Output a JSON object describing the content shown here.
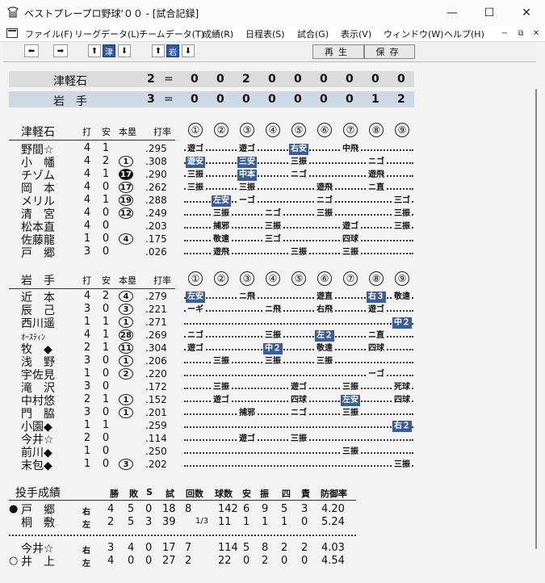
{
  "window": {
    "title": "ベストプレープロ野球'００ - [試合記録]",
    "buttons": [
      "—",
      "☐",
      "✕"
    ]
  },
  "menu": {
    "items": [
      "ファイル(F)",
      "リーグデータ(L)",
      "チームデータ(T)",
      "成績(R)",
      "日程表(S)",
      "試合(G)",
      "表示(V)",
      "ウィンドウ(W)",
      "ヘルプ(H)"
    ],
    "mdi": [
      "−",
      "⧉",
      "✕"
    ]
  },
  "toolbar": {
    "team1": "津",
    "team2": "岩",
    "play_label": "再生",
    "save_label": "保存"
  },
  "colors": {
    "highlight": "#3a5f96",
    "score_bg_1": "#dcdcdc",
    "score_bg_2": "#cfd9e6"
  },
  "scoreboard": [
    {
      "team": "津軽石",
      "total": "2",
      "eq": "=",
      "innings": [
        "0",
        "0",
        "2",
        "0",
        "0",
        "0",
        "0",
        "0",
        "0"
      ]
    },
    {
      "team": "岩　手",
      "total": "3",
      "eq": "=",
      "innings": [
        "0",
        "0",
        "0",
        "0",
        "0",
        "0",
        "0",
        "1",
        "2"
      ]
    }
  ],
  "batting_headers": {
    "ab": "打",
    "h": "安",
    "hr": "本塁",
    "avg": "打率"
  },
  "inning_labels": [
    "①",
    "②",
    "③",
    "④",
    "⑤",
    "⑥",
    "⑦",
    "⑧",
    "⑨"
  ],
  "team1": {
    "name": "津軽石",
    "players": [
      {
        "name": "野間☆",
        "ab": "4",
        "h": "1",
        "hr": "",
        "avg": ".295",
        "results": [
          [
            "0",
            "遊ゴ"
          ],
          [
            "2",
            "遊ゴ"
          ],
          [
            "4",
            "右安",
            "hl"
          ],
          [
            "6",
            "中飛"
          ]
        ]
      },
      {
        "name": "小　幡",
        "ab": "4",
        "h": "2",
        "hr": "1",
        "hrf": false,
        "avg": ".308",
        "results": [
          [
            "0",
            "遊安",
            "hl"
          ],
          [
            "2",
            "三安",
            "hl"
          ],
          [
            "4",
            "三振"
          ],
          [
            "7",
            "ニゴ"
          ]
        ]
      },
      {
        "name": "チゾム",
        "ab": "4",
        "h": "1",
        "hr": "17",
        "hrf": true,
        "avg": ".290",
        "results": [
          [
            "0",
            "三振"
          ],
          [
            "2",
            "中本",
            "hl"
          ],
          [
            "4",
            "ニゴ"
          ],
          [
            "7",
            "遊飛"
          ]
        ]
      },
      {
        "name": "岡　本",
        "ab": "4",
        "h": "0",
        "hr": "17",
        "hrf": false,
        "avg": ".262",
        "results": [
          [
            "0",
            "三振"
          ],
          [
            "2",
            "三振"
          ],
          [
            "5",
            "遊飛"
          ],
          [
            "7",
            "ニ直"
          ]
        ]
      },
      {
        "name": "メリル",
        "ab": "4",
        "h": "1",
        "hr": "19",
        "hrf": false,
        "avg": ".288",
        "results": [
          [
            "1",
            "左安",
            "hl"
          ],
          [
            "2",
            "ーゴ"
          ],
          [
            "5",
            "ニゴ"
          ],
          [
            "8",
            "三ゴ"
          ]
        ]
      },
      {
        "name": "清　宮",
        "ab": "4",
        "h": "0",
        "hr": "12",
        "hrf": false,
        "avg": ".249",
        "results": [
          [
            "1",
            "三振"
          ],
          [
            "3",
            "ニゴ"
          ],
          [
            "5",
            "三振"
          ],
          [
            "8",
            "三振"
          ]
        ]
      },
      {
        "name": "松本直",
        "ab": "4",
        "h": "0",
        "hr": "",
        "avg": ".203",
        "results": [
          [
            "1",
            "捕邪"
          ],
          [
            "3",
            "三振"
          ],
          [
            "6",
            "遊ゴ"
          ],
          [
            "8",
            "三振"
          ]
        ]
      },
      {
        "name": "佐藤龍",
        "ab": "1",
        "h": "0",
        "hr": "4",
        "hrf": false,
        "avg": ".175",
        "results": [
          [
            "1",
            "敬遠"
          ],
          [
            "3",
            "三ゴ"
          ],
          [
            "6",
            "四球"
          ]
        ]
      },
      {
        "name": "戸　郷",
        "ab": "3",
        "h": "0",
        "hr": "",
        "avg": ".026",
        "results": [
          [
            "1",
            "遊飛"
          ],
          [
            "4",
            "三振"
          ],
          [
            "6",
            "三振"
          ]
        ]
      }
    ]
  },
  "team2": {
    "name": "岩　手",
    "players": [
      {
        "name": "近　本",
        "ab": "4",
        "h": "2",
        "hr": "4",
        "hrf": false,
        "avg": ".279",
        "results": [
          [
            "0",
            "左安",
            "hl"
          ],
          [
            "2",
            "ニ飛"
          ],
          [
            "5",
            "遊直"
          ],
          [
            "7",
            "右３",
            "hl"
          ],
          [
            "8",
            "敬遠"
          ]
        ]
      },
      {
        "name": "辰　己",
        "ab": "3",
        "h": "0",
        "hr": "3",
        "hrf": false,
        "avg": ".221",
        "results": [
          [
            "0",
            "ーギ"
          ],
          [
            "3",
            "ニ飛"
          ],
          [
            "5",
            "右飛"
          ],
          [
            "7",
            "遊ゴ"
          ]
        ]
      },
      {
        "name": "西川遥",
        "ab": "1",
        "h": "1",
        "hr": "1",
        "hrf": false,
        "avg": ".271",
        "results": [
          [
            "8",
            "中２",
            "hl"
          ]
        ]
      },
      {
        "name": "ｵｰｽﾃｨﾝ",
        "ab": "4",
        "h": "1",
        "hr": "28",
        "hrf": false,
        "avg": ".269",
        "results": [
          [
            "0",
            "ニゴ"
          ],
          [
            "3",
            "三振"
          ],
          [
            "5",
            "左２",
            "hl"
          ],
          [
            "7",
            "ニ直"
          ]
        ]
      },
      {
        "name": "牧　◆",
        "ab": "2",
        "h": "1",
        "hr": "11",
        "hrf": false,
        "avg": ".304",
        "results": [
          [
            "0",
            "遊ゴ"
          ],
          [
            "3",
            "中２",
            "hl"
          ],
          [
            "5",
            "敬遠"
          ],
          [
            "7",
            "四球"
          ]
        ]
      },
      {
        "name": "浅　野",
        "ab": "3",
        "h": "0",
        "hr": "1",
        "hrf": false,
        "avg": ".206",
        "results": [
          [
            "1",
            "三振"
          ],
          [
            "3",
            "三振"
          ],
          [
            "5",
            "三振"
          ]
        ]
      },
      {
        "name": "宇佐見",
        "ab": "1",
        "h": "0",
        "hr": "2",
        "hrf": false,
        "avg": ".220",
        "results": [
          [
            "7",
            "ーゴ"
          ]
        ]
      },
      {
        "name": "滝　沢",
        "ab": "3",
        "h": "0",
        "hr": "",
        "avg": ".172",
        "results": [
          [
            "1",
            "三振"
          ],
          [
            "4",
            "遊ゴ"
          ],
          [
            "6",
            "三振"
          ],
          [
            "8",
            "死球"
          ]
        ]
      },
      {
        "name": "中村悠",
        "ab": "2",
        "h": "1",
        "hr": "1",
        "hrf": false,
        "avg": ".152",
        "results": [
          [
            "1",
            "遊ゴ"
          ],
          [
            "4",
            "四球"
          ],
          [
            "6",
            "左安",
            "hl"
          ],
          [
            "8",
            "四球"
          ]
        ]
      },
      {
        "name": "門　脇",
        "ab": "3",
        "h": "0",
        "hr": "1",
        "hrf": false,
        "avg": ".201",
        "results": [
          [
            "2",
            "捕邪"
          ],
          [
            "4",
            "ニゴ"
          ],
          [
            "6",
            "三振"
          ]
        ]
      },
      {
        "name": "小園◆",
        "ab": "1",
        "h": "1",
        "hr": "",
        "avg": ".259",
        "results": [
          [
            "8",
            "右２",
            "hl"
          ]
        ]
      },
      {
        "name": "今井☆",
        "ab": "2",
        "h": "0",
        "hr": "",
        "avg": ".114",
        "results": [
          [
            "2",
            "遊ゴ"
          ],
          [
            "4",
            "三振"
          ]
        ]
      },
      {
        "name": "前川◆",
        "ab": "1",
        "h": "0",
        "hr": "",
        "avg": ".250",
        "results": [
          [
            "6",
            "三振"
          ]
        ]
      },
      {
        "name": "末包◆",
        "ab": "1",
        "h": "0",
        "hr": "3",
        "hrf": false,
        "avg": ".202",
        "results": [
          [
            "8",
            "三振"
          ]
        ]
      }
    ]
  },
  "pitching": {
    "title": "投手成績",
    "headers": [
      "勝",
      "敗",
      "S",
      "試",
      "回数",
      "球数",
      "安",
      "振",
      "四",
      "責",
      "防御率"
    ],
    "rows": [
      {
        "mark": "●",
        "name": "戸　郷",
        "hand": "右",
        "w": "4",
        "l": "5",
        "s": "0",
        "g": "18",
        "ip": "8",
        "ipf": "",
        "np": "142",
        "h": "6",
        "k": "9",
        "bb": "5",
        "er": "3",
        "era": "4.20"
      },
      {
        "mark": "",
        "name": "桐　敷",
        "hand": "左",
        "w": "2",
        "l": "5",
        "s": "3",
        "g": "39",
        "ip": "",
        "ipf": "1/3",
        "np": "11",
        "h": "1",
        "k": "1",
        "bb": "1",
        "er": "0",
        "era": "5.24"
      },
      {
        "mark": "",
        "name": "今井☆",
        "hand": "右",
        "w": "3",
        "l": "4",
        "s": "0",
        "g": "17",
        "ip": "7",
        "ipf": "",
        "np": "114",
        "h": "5",
        "k": "8",
        "bb": "2",
        "er": "2",
        "era": "4.03"
      },
      {
        "mark": "○",
        "name": "井　上",
        "hand": "左",
        "w": "4",
        "l": "0",
        "s": "0",
        "g": "27",
        "ip": "2",
        "ipf": "",
        "np": "22",
        "h": "0",
        "k": "2",
        "bb": "0",
        "er": "0",
        "era": "4.54"
      }
    ]
  }
}
